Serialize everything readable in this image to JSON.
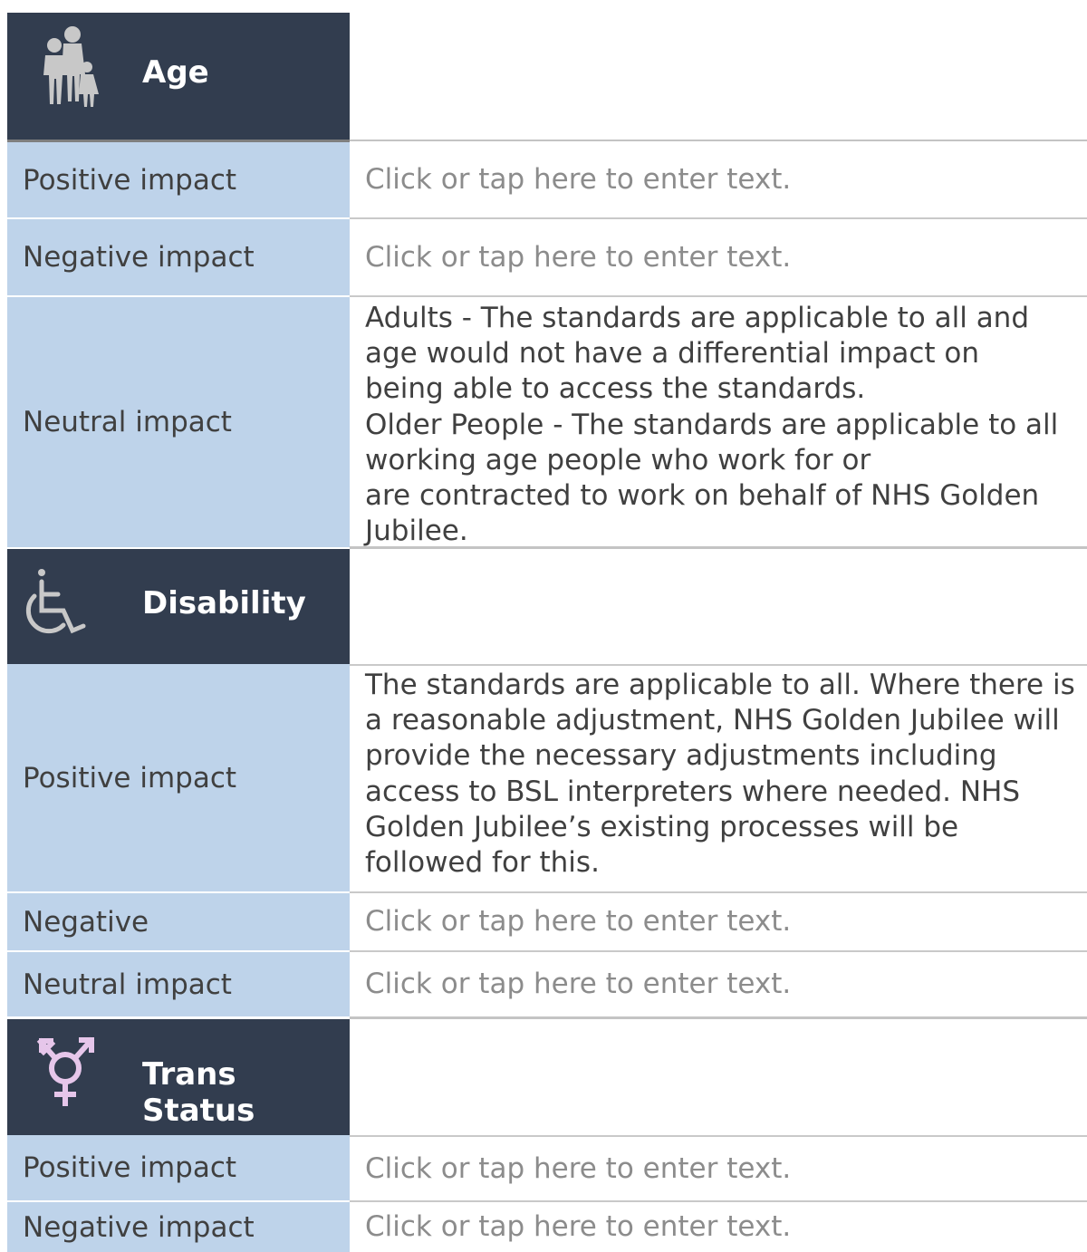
{
  "sections": {
    "age": {
      "title": "Age",
      "rows": [
        {
          "label": "Positive impact",
          "value": "Click or tap here to enter text."
        },
        {
          "label": "Negative impact",
          "value": "Click or tap here to enter text."
        },
        {
          "label": "Neutral impact",
          "value_lines": [
            "Adults - The standards are applicable to all and",
            "age would not have a differential impact on",
            "being able to access the standards.",
            "Older People - The standards are applicable to all",
            "working age people who work for or",
            "are contracted to work on behalf of NHS Golden",
            "Jubilee."
          ]
        }
      ]
    },
    "disability": {
      "title": "Disability",
      "rows": [
        {
          "label": "Positive impact",
          "value_lines": [
            "The standards are applicable to all. Where there is",
            "a reasonable adjustment, NHS Golden Jubilee will",
            "provide the necessary adjustments including",
            "access to BSL interpreters where needed. NHS",
            "Golden Jubilee’s existing processes will be",
            "followed for this."
          ]
        },
        {
          "label": "Negative",
          "value": "Click or tap here to enter text."
        },
        {
          "label": "Neutral impact",
          "value": "Click or tap here to enter text."
        }
      ]
    },
    "trans": {
      "title": "Trans Status",
      "rows": [
        {
          "label": "Positive impact",
          "value": "Click or tap here to enter text."
        },
        {
          "label": "Negative impact",
          "value": "Click or tap here to enter text."
        }
      ]
    }
  },
  "icons": {
    "age": "family-icon",
    "disability": "wheelchair-icon",
    "trans": "transgender-symbol-icon"
  },
  "colors": {
    "header_bg": "#323d4f",
    "label_bg": "#bed3ea",
    "placeholder": "#8c8c8c",
    "text": "#404040"
  }
}
